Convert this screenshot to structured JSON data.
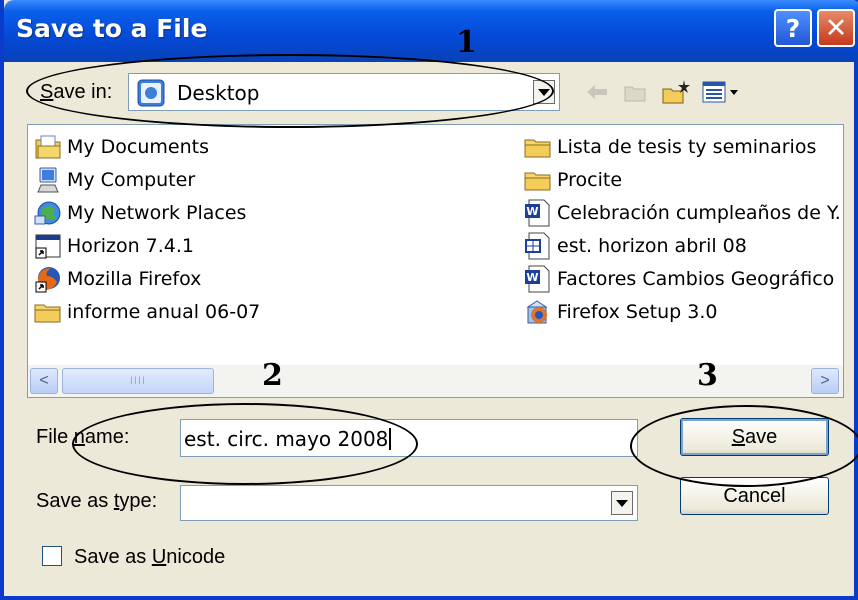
{
  "window": {
    "title": "Save to a File",
    "help_glyph": "?",
    "close_glyph": "✕"
  },
  "save_in": {
    "label_pre": "",
    "label_accel": "S",
    "label_post": "ave in:",
    "value": "Desktop"
  },
  "toolbar": {
    "icons": [
      "back-arrow-icon",
      "up-folder-icon",
      "new-folder-icon",
      "view-menu-icon"
    ]
  },
  "files": {
    "left": [
      {
        "name": "My Documents",
        "icon": "my-documents-icon"
      },
      {
        "name": "My Computer",
        "icon": "my-computer-icon"
      },
      {
        "name": "My Network Places",
        "icon": "network-places-icon"
      },
      {
        "name": "Horizon 7.4.1",
        "icon": "shortcut-app-icon"
      },
      {
        "name": "Mozilla Firefox",
        "icon": "firefox-icon"
      },
      {
        "name": "informe anual 06-07",
        "icon": "folder-icon"
      }
    ],
    "right": [
      {
        "name": "Lista de tesis ty seminarios",
        "icon": "folder-icon"
      },
      {
        "name": "Procite",
        "icon": "folder-icon"
      },
      {
        "name": "Celebración cumpleaños de Y.",
        "icon": "word-doc-icon"
      },
      {
        "name": "est. horizon abril 08",
        "icon": "spreadsheet-doc-icon"
      },
      {
        "name": "Factores Cambios Geográfico",
        "icon": "word-doc-icon"
      },
      {
        "name": "Firefox Setup 3.0",
        "icon": "installer-icon"
      }
    ]
  },
  "scrollbar": {
    "left_arrow": "<",
    "right_arrow": ">",
    "grip": "IIII"
  },
  "file_name": {
    "label_pre": "File ",
    "label_accel": "n",
    "label_post": "ame:",
    "value": "est. circ. mayo 2008"
  },
  "save_as_type": {
    "label_pre": "Save as ",
    "label_accel": "t",
    "label_post": "ype:",
    "value": ""
  },
  "buttons": {
    "save": {
      "pre": "",
      "accel": "S",
      "post": "ave"
    },
    "cancel": {
      "label": "Cancel"
    }
  },
  "unicode": {
    "label_pre": "Save as ",
    "label_accel": "U",
    "label_post": "nicode",
    "checked": false
  },
  "annotations": {
    "one": "1",
    "two": "2",
    "three": "3"
  },
  "colors": {
    "title_bar": "#0549d8",
    "window_bg": "#ece9d8",
    "close_button": "#c5391d",
    "field_border": "#7f9db9"
  }
}
